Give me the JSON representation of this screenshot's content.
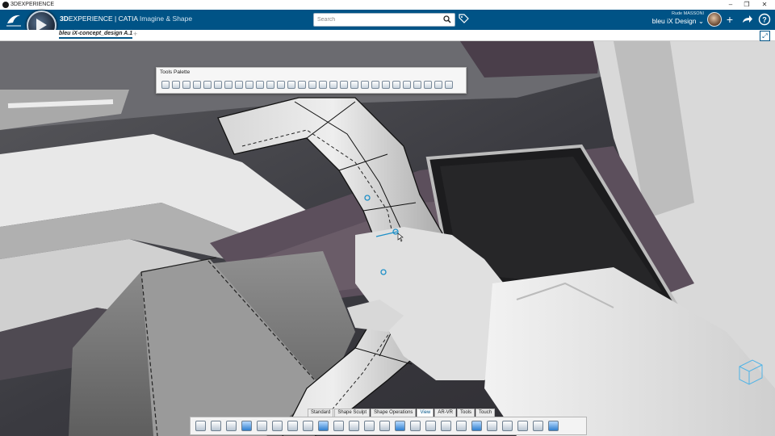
{
  "window": {
    "title": "3DEXPERIENCE",
    "controls": [
      "–",
      "❐",
      "✕"
    ]
  },
  "header": {
    "brand_primary": "3D",
    "brand_secondary": "EXPERIENCE | CATIA",
    "brand_app": "Imagine & Shape",
    "search": {
      "placeholder": "Search",
      "value": ""
    },
    "user": {
      "name": "Rude MASSONI",
      "space": "bleu iX Design ⌄"
    },
    "icons": [
      "tag-icon",
      "add-icon",
      "share-icon",
      "help-icon"
    ],
    "accent_color": "#005386"
  },
  "tabs": {
    "active": "bleu iX-concept_design A.1",
    "add": "+"
  },
  "palette": {
    "title": "Tools Palette",
    "tool_count": 28
  },
  "action_bar": {
    "tabs": [
      "Standard",
      "Shape Sculpt",
      "Shape Operations",
      "View",
      "AR-VR",
      "Tools",
      "Touch"
    ],
    "active_tab": "View",
    "button_count": 24
  }
}
